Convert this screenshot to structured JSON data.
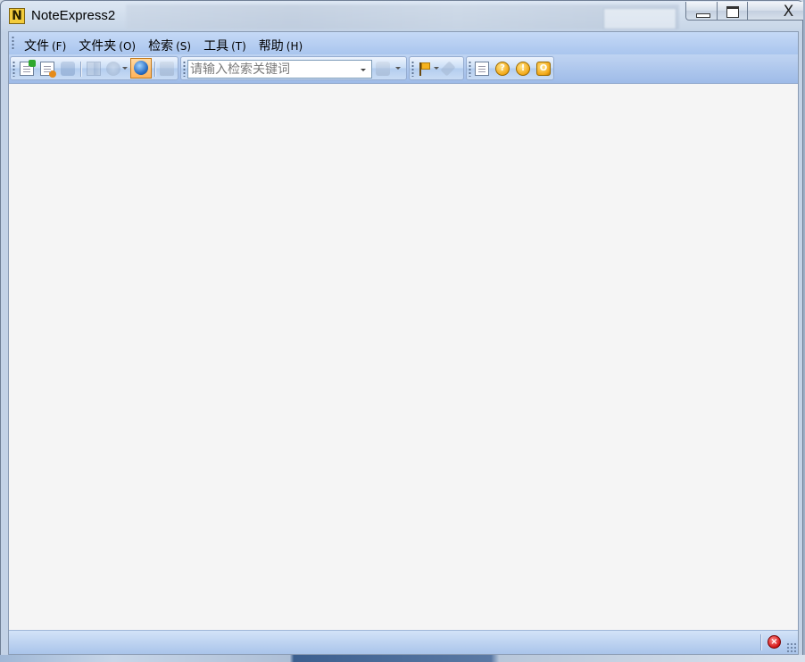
{
  "window": {
    "title": "NoteExpress2",
    "app_icon_letter": "N",
    "close_glyph": "X"
  },
  "menu": {
    "items": [
      {
        "label": "文件",
        "accel": "(F)"
      },
      {
        "label": "文件夹",
        "accel": "(O)"
      },
      {
        "label": "检索",
        "accel": "(S)"
      },
      {
        "label": "工具",
        "accel": "(T)"
      },
      {
        "label": "帮助",
        "accel": "(H)"
      }
    ]
  },
  "toolbar": {
    "search_placeholder": "请输入检索关键词",
    "icons": [
      "new-reference-icon",
      "copy-reference-icon",
      "database-icon",
      "book-icon",
      "online-search-icon",
      "web-globe-icon",
      "import-icon",
      "search-go-icon",
      "flag-icon",
      "tag-icon",
      "notes-icon",
      "help-icon",
      "info-icon",
      "about-icon"
    ],
    "help_glyph": "?",
    "info_glyph": "!",
    "about_glyph": "O"
  },
  "statusbar": {
    "close_glyph": "×"
  },
  "colors": {
    "menubar": "#b7cff1",
    "toolbar": "#c8dcf6",
    "client_bg": "#f5f5f5",
    "accent_orange": "#f2a818"
  }
}
